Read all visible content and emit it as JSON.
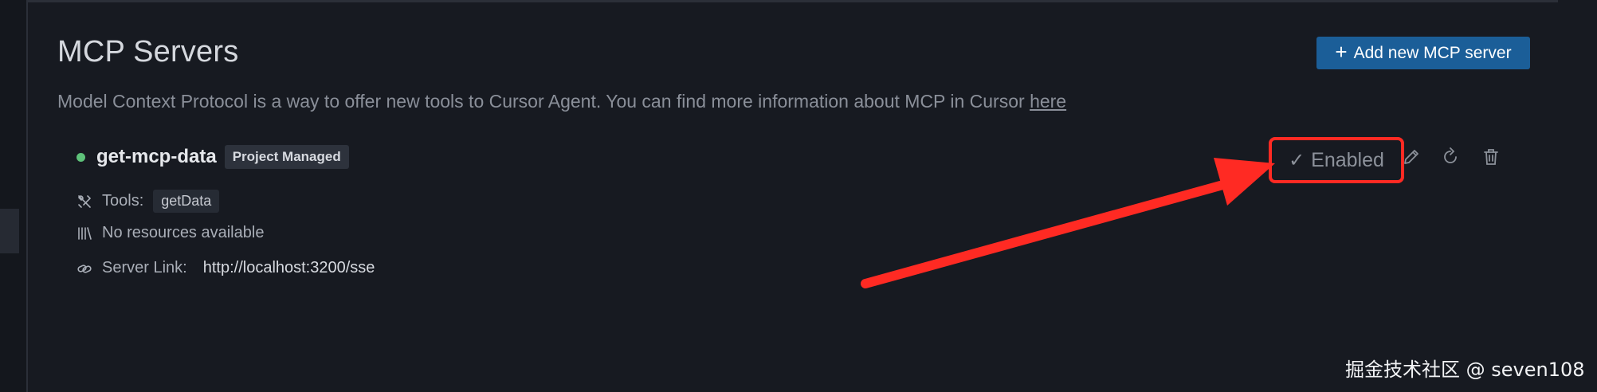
{
  "page": {
    "title": "MCP Servers",
    "add_button_label": "Add new MCP server",
    "description_text": "Model Context Protocol is a way to offer new tools to Cursor Agent. You can find more information about MCP in Cursor ",
    "description_link": "here"
  },
  "server": {
    "status_color": "#5ec27a",
    "name": "get-mcp-data",
    "badge": "Project Managed",
    "tools_label": "Tools:",
    "tools": [
      "getData"
    ],
    "resources_text": "No resources available",
    "link_label": "Server Link:",
    "link_url": "http://localhost:3200/sse",
    "enabled_label": "Enabled"
  },
  "icons": {
    "add": "plus-icon",
    "tools": "tools-icon",
    "resources": "library-icon",
    "link": "link-icon",
    "enabled": "check-icon",
    "edit": "pencil-icon",
    "refresh": "refresh-icon",
    "delete": "trash-icon"
  },
  "colors": {
    "accent": "#1b5e98",
    "highlight": "#ff2a23",
    "background": "#171a21"
  },
  "watermark": "掘金技术社区 @ seven108"
}
